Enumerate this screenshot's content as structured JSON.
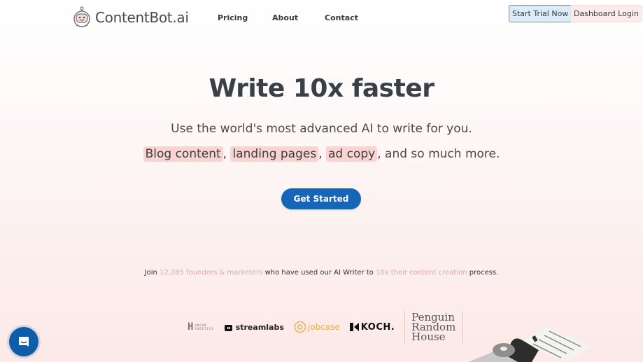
{
  "nav": {
    "brand": "ContentBot.ai",
    "links": [
      "Pricing",
      "About",
      "Contact"
    ],
    "start_trial": "Start Trial Now",
    "dashboard_login": "Dashboard Login"
  },
  "hero": {
    "title": "Write 10x faster",
    "subtitle": "Use the world's most advanced AI to write for you.",
    "highlights": [
      "Blog content",
      "landing pages",
      "ad copy"
    ],
    "sep": ",",
    "tail": ", and so much more.",
    "cta": "Get Started"
  },
  "social_proof": {
    "prefix": "Join ",
    "count_text": "12,285 founders & marketers",
    "middle": " who have used our AI Writer to ",
    "accent2": "10x their content creation",
    "suffix": " process."
  },
  "logos": {
    "hanson_big": "H",
    "hanson_small1": "ANSON",
    "hanson_small2": "ROBOTICS",
    "streamlabs": "streamlabs",
    "jobcase": "jobcase",
    "koch": "KOCH.",
    "penguin": [
      "Penguin",
      "Random",
      "House"
    ]
  },
  "colors": {
    "primary": "#1565b8",
    "highlight": "#fad4d2",
    "accent_text": "#e3a8a0"
  }
}
